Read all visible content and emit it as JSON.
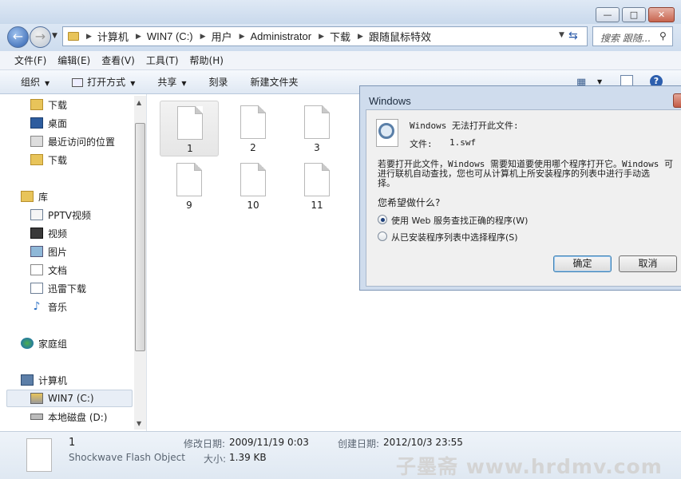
{
  "window": {
    "minimize_icon": "minimize-icon",
    "maximize_icon": "maximize-icon",
    "close_icon": "close-icon"
  },
  "address": {
    "crumbs": [
      "计算机",
      "WIN7 (C:)",
      "用户",
      "Administrator",
      "下载",
      "跟随鼠标特效"
    ],
    "search_placeholder": "搜索 跟随..."
  },
  "menu": [
    "文件(F)",
    "编辑(E)",
    "查看(V)",
    "工具(T)",
    "帮助(H)"
  ],
  "toolbar": {
    "organize": "组织",
    "open_with": "打开方式",
    "share": "共享",
    "burn": "刻录",
    "new_folder": "新建文件夹"
  },
  "nav": {
    "favorites": [
      "下载",
      "桌面",
      "最近访问的位置",
      "下载"
    ],
    "library": "库",
    "libraries": [
      "PPTV视频",
      "视频",
      "图片",
      "文档",
      "迅雷下载",
      "音乐"
    ],
    "homegroup": "家庭组",
    "computer": "计算机",
    "drives": [
      "WIN7 (C:)",
      "本地磁盘 (D:)"
    ]
  },
  "files": [
    {
      "name": "1",
      "selected": true
    },
    {
      "name": "2",
      "selected": false
    },
    {
      "name": "3",
      "selected": false
    },
    {
      "name": "9",
      "selected": false
    },
    {
      "name": "10",
      "selected": false
    },
    {
      "name": "11",
      "selected": false
    }
  ],
  "details": {
    "name": "1",
    "type": "Shockwave Flash Object",
    "modified_label": "修改日期:",
    "modified": "2009/11/19 0:03",
    "size_label": "大小:",
    "size": "1.39 KB",
    "created_label": "创建日期:",
    "created": "2012/10/3 23:55"
  },
  "watermark": "子墨斋 www.hrdmv.com",
  "dialog": {
    "title": "Windows",
    "heading": "Windows 无法打开此文件:",
    "file_label": "文件:",
    "file_name": "1.swf",
    "body_line1": "若要打开此文件，Windows 需要知道要使用哪个程序打开它。Windows 可",
    "body_line2": "进行联机自动查找，您也可从计算机上所安装程序的列表中进行手动选",
    "body_line3": "择。",
    "question": "您希望做什么?",
    "option1": "使用 Web 服务查找正确的程序(W)",
    "option2": "从已安装程序列表中选择程序(S)",
    "selected_option": 1,
    "ok": "确定",
    "cancel": "取消"
  }
}
